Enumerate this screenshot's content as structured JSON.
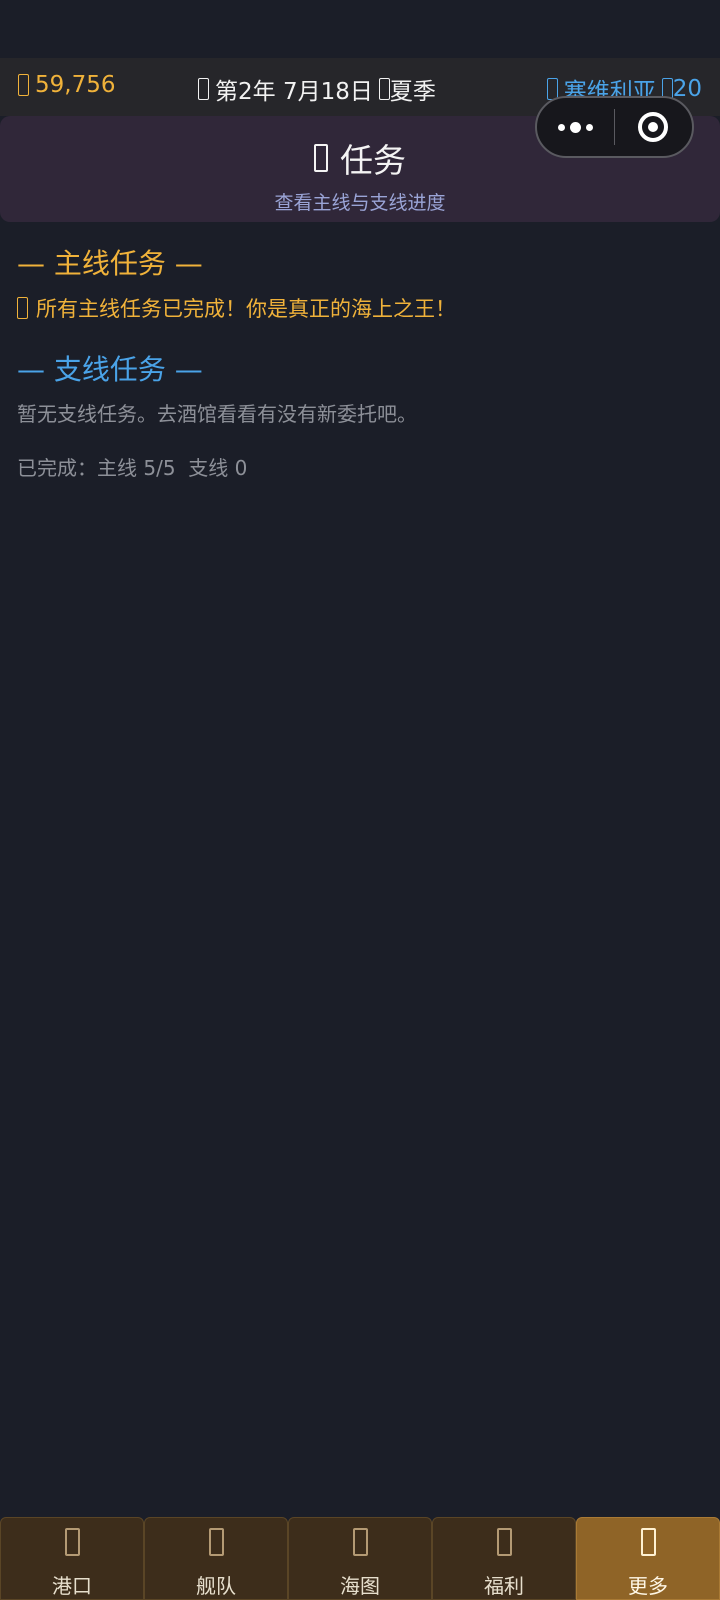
{
  "topbar": {
    "gold_icon": "coin-icon",
    "gold": "59,756",
    "date_icon": "calendar-icon",
    "date": "第2年 7月18日",
    "season_icon": "sun-icon",
    "season": "夏季",
    "port_icon": "anchor-icon",
    "port": "塞维利亚",
    "ships_icon": "ship-icon",
    "ships": "20"
  },
  "header": {
    "icon": "scroll-icon",
    "title": "任务",
    "subtitle": "查看主线与支线进度"
  },
  "main_quests": {
    "title": "— 主线任务 —",
    "icon": "trophy-icon",
    "message": "所有主线任务已完成！你是真正的海上之王！"
  },
  "side_quests": {
    "title": "— 支线任务 —",
    "message": "暂无支线任务。去酒馆看看有没有新委托吧。"
  },
  "summary": "已完成：主线 5/5  支线 0",
  "tabs": [
    {
      "label": "港口",
      "icon": "harbor-icon"
    },
    {
      "label": "舰队",
      "icon": "fleet-icon"
    },
    {
      "label": "海图",
      "icon": "map-icon"
    },
    {
      "label": "福利",
      "icon": "gift-icon"
    },
    {
      "label": "更多",
      "icon": "more-icon",
      "active": true
    }
  ],
  "colors": {
    "background": "#1b1e28",
    "gold": "#f0b23a",
    "blue": "#4aa3e8",
    "active_tab": "#8f6427"
  }
}
